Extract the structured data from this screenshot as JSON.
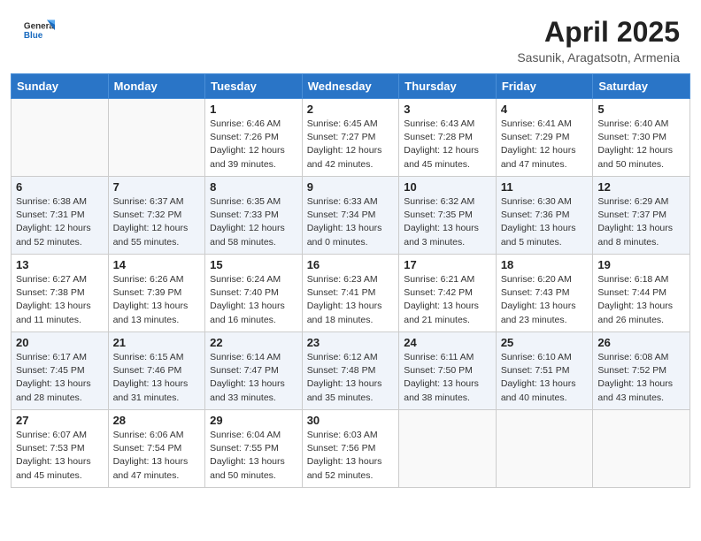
{
  "header": {
    "logo_general": "General",
    "logo_blue": "Blue",
    "month_title": "April 2025",
    "location": "Sasunik, Aragatsotn, Armenia"
  },
  "weekdays": [
    "Sunday",
    "Monday",
    "Tuesday",
    "Wednesday",
    "Thursday",
    "Friday",
    "Saturday"
  ],
  "weeks": [
    [
      {
        "day": "",
        "info": ""
      },
      {
        "day": "",
        "info": ""
      },
      {
        "day": "1",
        "info": "Sunrise: 6:46 AM\nSunset: 7:26 PM\nDaylight: 12 hours\nand 39 minutes."
      },
      {
        "day": "2",
        "info": "Sunrise: 6:45 AM\nSunset: 7:27 PM\nDaylight: 12 hours\nand 42 minutes."
      },
      {
        "day": "3",
        "info": "Sunrise: 6:43 AM\nSunset: 7:28 PM\nDaylight: 12 hours\nand 45 minutes."
      },
      {
        "day": "4",
        "info": "Sunrise: 6:41 AM\nSunset: 7:29 PM\nDaylight: 12 hours\nand 47 minutes."
      },
      {
        "day": "5",
        "info": "Sunrise: 6:40 AM\nSunset: 7:30 PM\nDaylight: 12 hours\nand 50 minutes."
      }
    ],
    [
      {
        "day": "6",
        "info": "Sunrise: 6:38 AM\nSunset: 7:31 PM\nDaylight: 12 hours\nand 52 minutes."
      },
      {
        "day": "7",
        "info": "Sunrise: 6:37 AM\nSunset: 7:32 PM\nDaylight: 12 hours\nand 55 minutes."
      },
      {
        "day": "8",
        "info": "Sunrise: 6:35 AM\nSunset: 7:33 PM\nDaylight: 12 hours\nand 58 minutes."
      },
      {
        "day": "9",
        "info": "Sunrise: 6:33 AM\nSunset: 7:34 PM\nDaylight: 13 hours\nand 0 minutes."
      },
      {
        "day": "10",
        "info": "Sunrise: 6:32 AM\nSunset: 7:35 PM\nDaylight: 13 hours\nand 3 minutes."
      },
      {
        "day": "11",
        "info": "Sunrise: 6:30 AM\nSunset: 7:36 PM\nDaylight: 13 hours\nand 5 minutes."
      },
      {
        "day": "12",
        "info": "Sunrise: 6:29 AM\nSunset: 7:37 PM\nDaylight: 13 hours\nand 8 minutes."
      }
    ],
    [
      {
        "day": "13",
        "info": "Sunrise: 6:27 AM\nSunset: 7:38 PM\nDaylight: 13 hours\nand 11 minutes."
      },
      {
        "day": "14",
        "info": "Sunrise: 6:26 AM\nSunset: 7:39 PM\nDaylight: 13 hours\nand 13 minutes."
      },
      {
        "day": "15",
        "info": "Sunrise: 6:24 AM\nSunset: 7:40 PM\nDaylight: 13 hours\nand 16 minutes."
      },
      {
        "day": "16",
        "info": "Sunrise: 6:23 AM\nSunset: 7:41 PM\nDaylight: 13 hours\nand 18 minutes."
      },
      {
        "day": "17",
        "info": "Sunrise: 6:21 AM\nSunset: 7:42 PM\nDaylight: 13 hours\nand 21 minutes."
      },
      {
        "day": "18",
        "info": "Sunrise: 6:20 AM\nSunset: 7:43 PM\nDaylight: 13 hours\nand 23 minutes."
      },
      {
        "day": "19",
        "info": "Sunrise: 6:18 AM\nSunset: 7:44 PM\nDaylight: 13 hours\nand 26 minutes."
      }
    ],
    [
      {
        "day": "20",
        "info": "Sunrise: 6:17 AM\nSunset: 7:45 PM\nDaylight: 13 hours\nand 28 minutes."
      },
      {
        "day": "21",
        "info": "Sunrise: 6:15 AM\nSunset: 7:46 PM\nDaylight: 13 hours\nand 31 minutes."
      },
      {
        "day": "22",
        "info": "Sunrise: 6:14 AM\nSunset: 7:47 PM\nDaylight: 13 hours\nand 33 minutes."
      },
      {
        "day": "23",
        "info": "Sunrise: 6:12 AM\nSunset: 7:48 PM\nDaylight: 13 hours\nand 35 minutes."
      },
      {
        "day": "24",
        "info": "Sunrise: 6:11 AM\nSunset: 7:50 PM\nDaylight: 13 hours\nand 38 minutes."
      },
      {
        "day": "25",
        "info": "Sunrise: 6:10 AM\nSunset: 7:51 PM\nDaylight: 13 hours\nand 40 minutes."
      },
      {
        "day": "26",
        "info": "Sunrise: 6:08 AM\nSunset: 7:52 PM\nDaylight: 13 hours\nand 43 minutes."
      }
    ],
    [
      {
        "day": "27",
        "info": "Sunrise: 6:07 AM\nSunset: 7:53 PM\nDaylight: 13 hours\nand 45 minutes."
      },
      {
        "day": "28",
        "info": "Sunrise: 6:06 AM\nSunset: 7:54 PM\nDaylight: 13 hours\nand 47 minutes."
      },
      {
        "day": "29",
        "info": "Sunrise: 6:04 AM\nSunset: 7:55 PM\nDaylight: 13 hours\nand 50 minutes."
      },
      {
        "day": "30",
        "info": "Sunrise: 6:03 AM\nSunset: 7:56 PM\nDaylight: 13 hours\nand 52 minutes."
      },
      {
        "day": "",
        "info": ""
      },
      {
        "day": "",
        "info": ""
      },
      {
        "day": "",
        "info": ""
      }
    ]
  ]
}
